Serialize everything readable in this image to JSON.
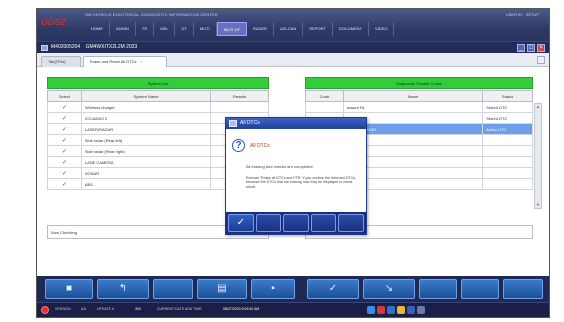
{
  "app": {
    "logo": "GDS2",
    "title": "GM VEHICLE ELECTRICAL DIAGNOSTIC INFORMATION CENTER",
    "user": "USER ID · SETUP"
  },
  "menu": [
    "HOME",
    "ADMIN",
    "TR",
    "MEL",
    "DT",
    "MUTI",
    "MUTI-DF",
    "RADER",
    "ASI-CAN",
    "REPORT",
    "DOCUMENT",
    "VIDEO"
  ],
  "vehicle": {
    "id": "M402005204",
    "model": "GM4WXITX2L2M 2023"
  },
  "tabs": [
    {
      "label": "Tab(ITHs)"
    },
    {
      "label": "Erase and Reset All DTCs"
    }
  ],
  "system_list": {
    "header": "System List",
    "columns": [
      "Select",
      "System Name",
      "Results"
    ],
    "rows": [
      {
        "check": "✓",
        "name": "Wireless charger"
      },
      {
        "check": "✓",
        "name": "ICC/ADAS 2"
      },
      {
        "check": "✓",
        "name": "LASER/RADAR"
      },
      {
        "check": "✓",
        "name": "Side radar (Rear left)"
      },
      {
        "check": "✓",
        "name": "Side radar (Rear right)"
      },
      {
        "check": "✓",
        "name": "LANE CAMERA"
      },
      {
        "check": "✓",
        "name": "SONAR"
      },
      {
        "check": "✓",
        "name": "ABS"
      }
    ]
  },
  "dtc_list": {
    "header": "Diagnostic Trouble Codes",
    "columns": [
      "Code",
      "Name",
      "Status"
    ],
    "rows": [
      {
        "code": "",
        "name": "essure RL",
        "status": "Stored DTC"
      },
      {
        "code": "",
        "name": "ran (BRJ)",
        "status": "Stored DTC"
      },
      {
        "code": "",
        "name": "CONTROL UNIT",
        "status": "Active DTC"
      }
    ]
  },
  "status": {
    "left": "Now Checking",
    "right": ""
  },
  "modal": {
    "title": "All DTCs",
    "heading": "All DTCs",
    "message": "All erasing and checks are completed.",
    "note": "Execute \"Erase all DTCs and FFD\" if you confirm the detected DTCs, because the DTCs that are erasing now may be displayed in check result."
  },
  "taskbar": {
    "version_label": "VERSION",
    "version": "4.0",
    "update_label": "UPDATE #",
    "update": "300",
    "datetime_label": "CURRENT DATE AND TIME",
    "datetime": "08/27/2023 9:09:00 AM"
  },
  "icons": {
    "toolbar": [
      "home-icon",
      "back-icon",
      "print-icon",
      "save-icon",
      "check-icon",
      "cancel-icon"
    ],
    "modal": [
      "check-icon"
    ]
  },
  "colors": {
    "panel_header": "#33cc3a",
    "selected_row": "#6d9ee8",
    "titlebar": "#2f3a66",
    "modal_heading": "#b8321f"
  }
}
